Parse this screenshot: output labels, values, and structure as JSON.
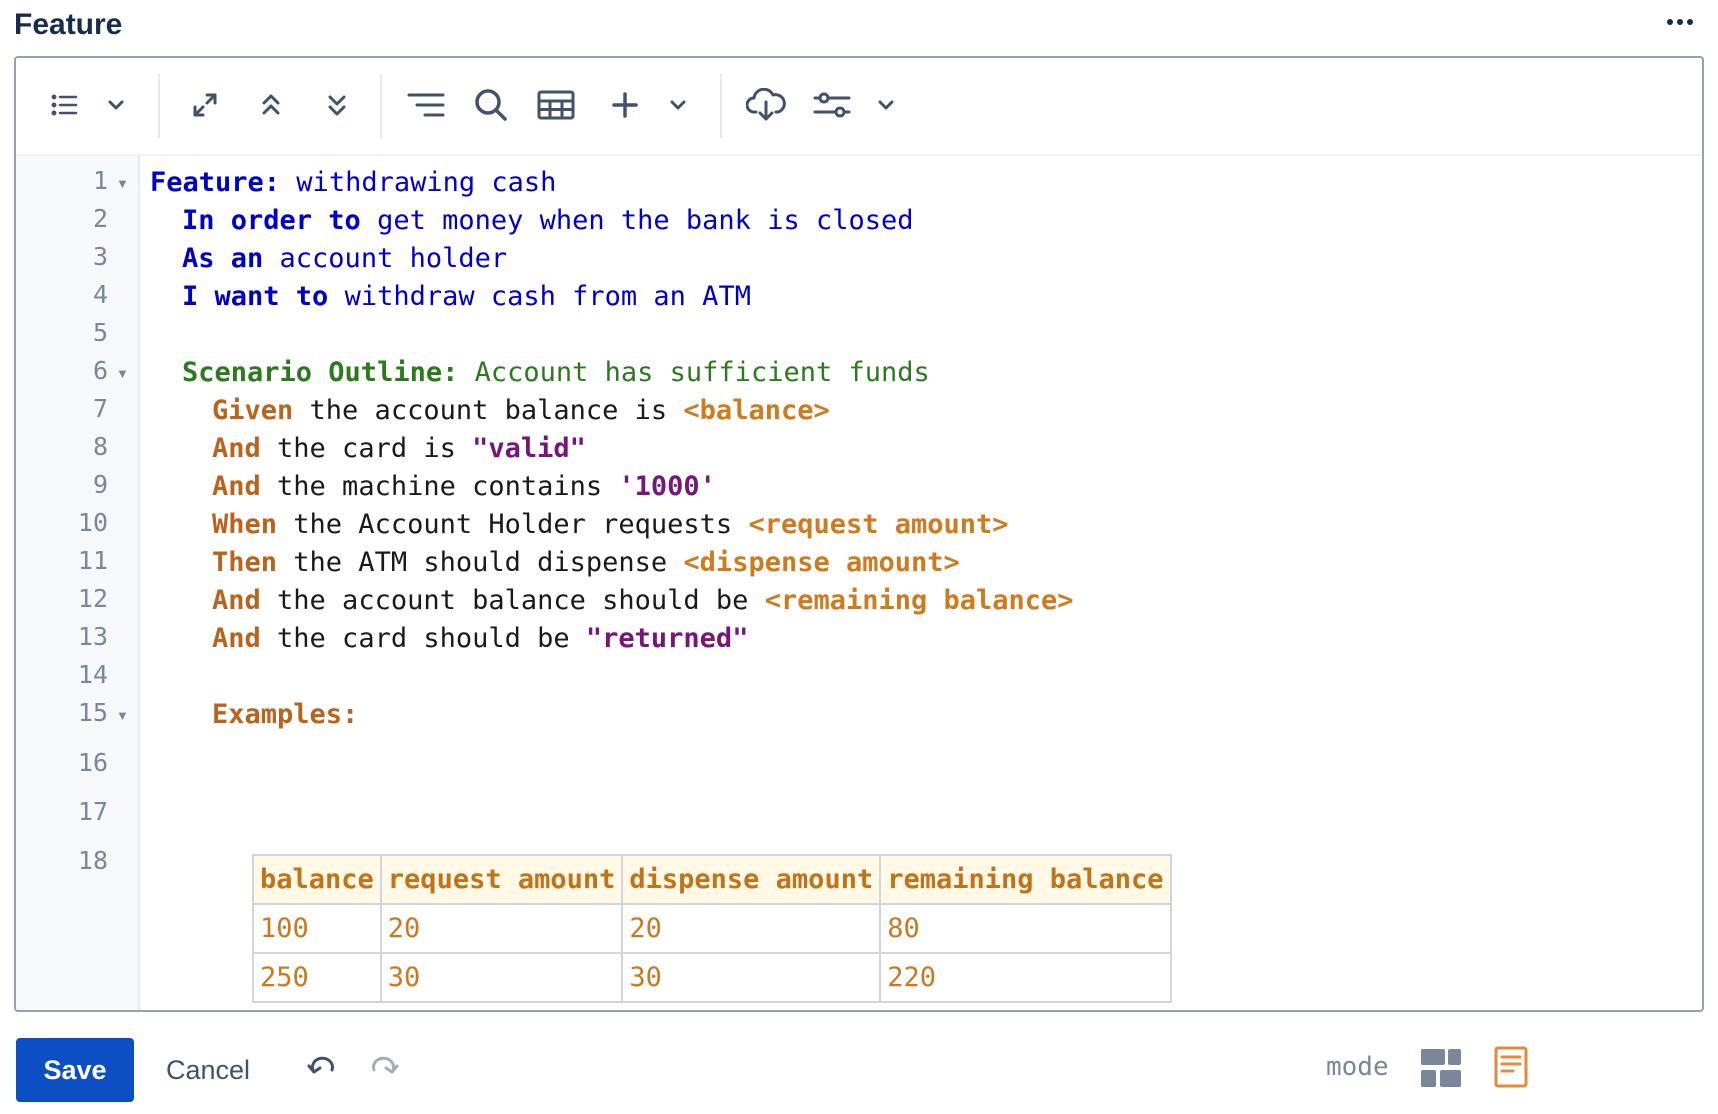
{
  "header": {
    "title": "Feature",
    "more_label": "···"
  },
  "colors": {
    "primary": "#0c4fc4",
    "keyword_blue": "#0000cc",
    "scenario_green": "#2c7a1e",
    "step_brown": "#b8641f",
    "param_orange": "#d07a1e",
    "string_purple": "#78157a"
  },
  "toolbar": {
    "icons": [
      "list-icon",
      "chevron-down-icon",
      "expand-icon",
      "collapse-up-icon",
      "expand-down-icon",
      "align-right-icon",
      "search-icon",
      "table-icon",
      "plus-icon",
      "chevron-down-icon",
      "cloud-download-icon",
      "sliders-icon",
      "chevron-down-icon"
    ]
  },
  "editor": {
    "line_numbers": [
      "1",
      "2",
      "3",
      "4",
      "5",
      "6",
      "7",
      "8",
      "9",
      "10",
      "11",
      "12",
      "13",
      "14",
      "15",
      "16",
      "17",
      "18"
    ],
    "lines": {
      "l1": {
        "kw": "Feature:",
        "text": " withdrawing cash"
      },
      "l2": {
        "kw": "In order to",
        "text": " get money when the bank is closed"
      },
      "l3": {
        "kw": "As an",
        "text": " account holder"
      },
      "l4": {
        "kw": "I want to",
        "text": " withdraw cash from an ATM"
      },
      "l6": {
        "kw": "Scenario Outline:",
        "text": " Account has sufficient funds"
      },
      "l7": {
        "kw": "Given",
        "text": " the account balance is ",
        "param": "<balance>"
      },
      "l8": {
        "kw": "And",
        "text": " the card is ",
        "str": "\"valid\""
      },
      "l9": {
        "kw": "And",
        "text": " the machine contains ",
        "str": "'1000'"
      },
      "l10": {
        "kw": "When",
        "text": " the Account Holder requests ",
        "param": "<request amount>"
      },
      "l11": {
        "kw": "Then",
        "text": " the ATM should dispense ",
        "param": "<dispense amount>"
      },
      "l12": {
        "kw": "And",
        "text": " the account balance should be ",
        "param": "<remaining balance>"
      },
      "l13": {
        "kw": "And",
        "text": " the card should be ",
        "str": "\"returned\""
      },
      "l15": {
        "kw": "Examples:"
      }
    },
    "examples": {
      "headers": [
        "balance",
        "request amount",
        "dispense amount",
        "remaining balance"
      ],
      "rows": [
        [
          "100",
          "20",
          "20",
          "80"
        ],
        [
          "250",
          "30",
          "30",
          "220"
        ]
      ]
    }
  },
  "footer": {
    "save_label": "Save",
    "cancel_label": "Cancel",
    "mode_label": "mode"
  }
}
